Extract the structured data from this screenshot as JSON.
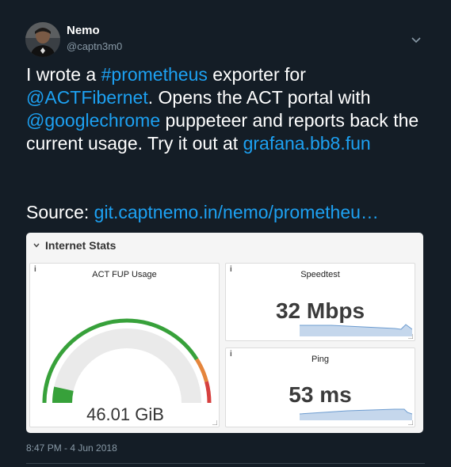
{
  "author": {
    "name": "Nemo",
    "handle": "@captn3m0"
  },
  "tweet": {
    "text_1": "I wrote a ",
    "link_hashtag": "#prometheus",
    "text_2": " exporter for ",
    "link_mention_act": "@ACTFibernet",
    "text_3": ". Opens the ACT portal with ",
    "link_mention_chrome": "@googlechrome",
    "text_4": " puppeteer and reports back the current usage. Try it out at ",
    "link_url": "grafana.bb8.fun",
    "source_label": "Source: ",
    "source_link": "git.captnemo.in/nemo/prometheu…"
  },
  "media": {
    "row_title": "Internet Stats",
    "info_glyph": "i",
    "gauge": {
      "title": "ACT FUP Usage",
      "value": "46.01 GiB",
      "fraction": 0.07
    },
    "speedtest": {
      "title": "Speedtest",
      "value": "32 Mbps"
    },
    "ping": {
      "title": "Ping",
      "value": "53 ms"
    }
  },
  "timestamp": "8:47 PM - 4 Jun 2018",
  "colors": {
    "background": "#141d26",
    "link": "#1da1f2",
    "muted": "#8899a6",
    "gauge_green": "#37a13a",
    "gauge_orange": "#e5853c",
    "gauge_red": "#d6403f",
    "spark": "#6d9cd0"
  }
}
